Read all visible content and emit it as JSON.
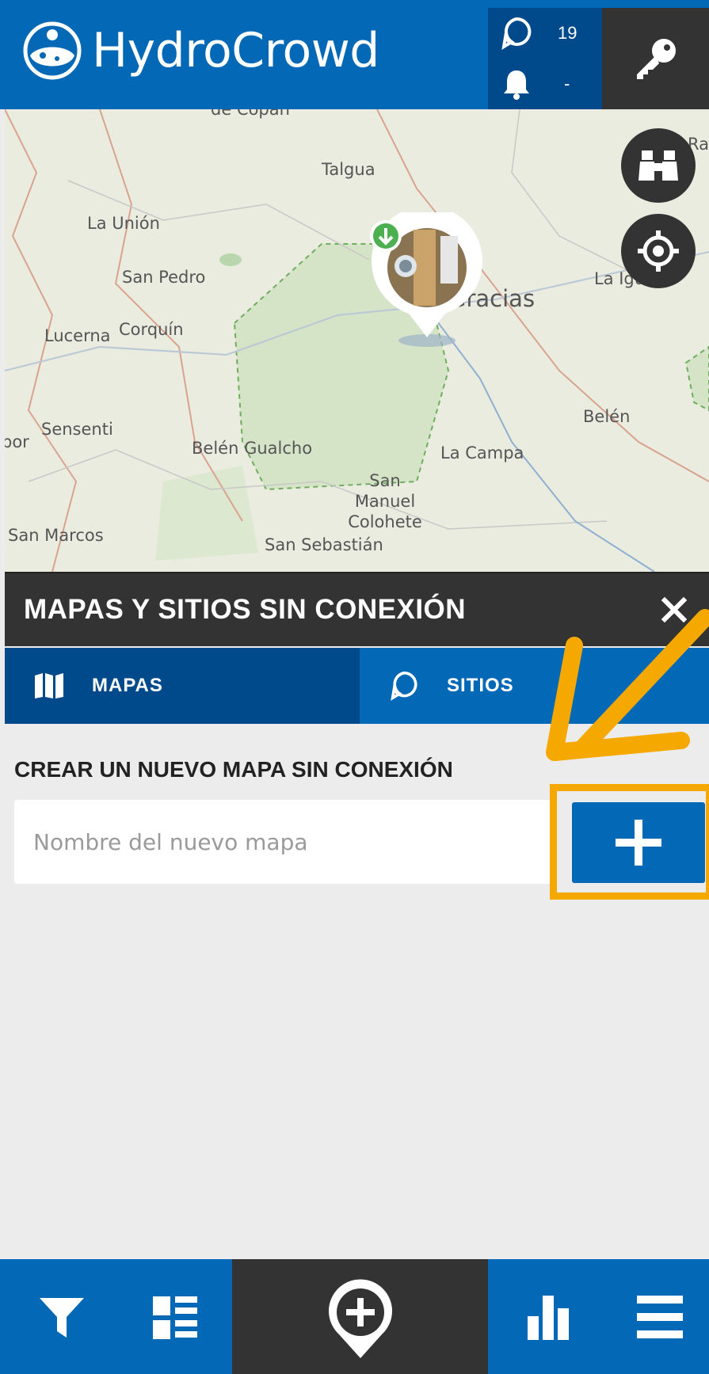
{
  "app": {
    "title": "HydroCrowd"
  },
  "header": {
    "sites_count": "19",
    "notifications_count": "-"
  },
  "map": {
    "labels": [
      "de Copán",
      "Talgua",
      "La Unión",
      "San Pedro",
      "Lucerna",
      "Corquín",
      "Gracias",
      "La Iguala",
      "Sensenti",
      "Belén Gualcho",
      "La Campa",
      "San Manuel Colohete",
      "Belén",
      "San Marcos",
      "San Sebastián",
      "bor",
      "Raf"
    ]
  },
  "panel": {
    "title": "MAPAS Y SITIOS SIN CONEXIÓN",
    "tabs": [
      {
        "label": "MAPAS",
        "active": true
      },
      {
        "label": "SITIOS",
        "active": false
      }
    ],
    "section_title": "CREAR UN NUEVO MAPA SIN CONEXIÓN",
    "input": {
      "placeholder": "Nombre del nuevo mapa",
      "value": ""
    }
  },
  "colors": {
    "primary": "#0368b5",
    "primary_dark": "#00498a",
    "dark": "#333333",
    "highlight": "#f5a800"
  },
  "icons": {
    "header": [
      "hydrocrowd-logo-icon",
      "site-marker-icon",
      "bell-icon",
      "key-icon"
    ],
    "map": [
      "binoculars-icon",
      "crosshair-icon",
      "download-badge-icon"
    ],
    "panel": [
      "close-icon",
      "map-icon",
      "site-marker-icon",
      "plus-icon"
    ],
    "bottom": [
      "filter-icon",
      "list-icon",
      "add-site-icon",
      "bar-chart-icon",
      "menu-icon"
    ]
  }
}
